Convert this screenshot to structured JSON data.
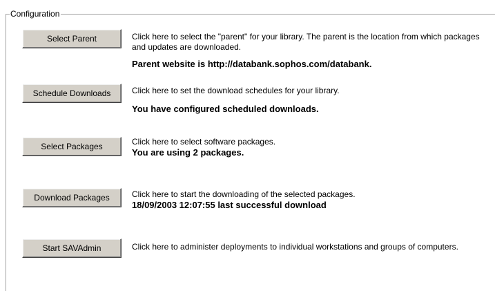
{
  "group_title": "Configuration",
  "rows": [
    {
      "button_label": "Select Parent",
      "description": "Click here to select the \"parent\" for your library. The parent is the location from which packages and updates are downloaded.",
      "status": "Parent website is http://databank.sophos.com/databank."
    },
    {
      "button_label": "Schedule Downloads",
      "description": "Click here to set the download schedules for your library.",
      "status": "You have configured scheduled downloads."
    },
    {
      "button_label": "Select Packages",
      "description": "Click here to select software packages.",
      "status": "You are using 2 packages."
    },
    {
      "button_label": "Download Packages",
      "description": "Click here to start the downloading of the selected packages.",
      "status": "18/09/2003 12:07:55 last successful download"
    },
    {
      "button_label": "Start SAVAdmin",
      "description": "Click here to administer deployments to individual workstations and groups of computers.",
      "status": ""
    }
  ]
}
